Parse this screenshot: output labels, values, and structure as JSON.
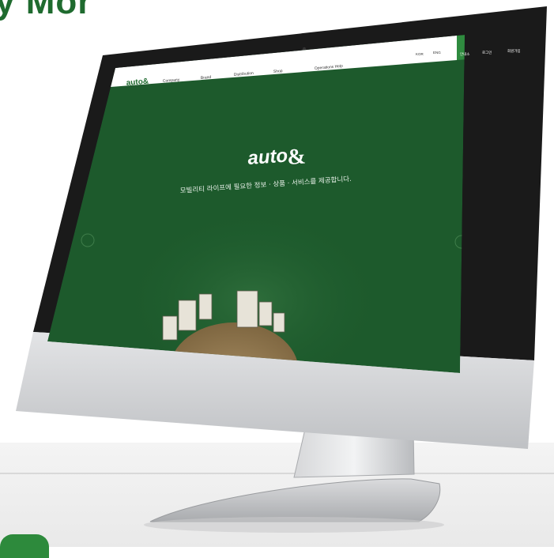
{
  "headline": "y Mor",
  "site": {
    "logo_text": "auto",
    "logo_mark": "&",
    "nav": [
      "Company",
      "Brand",
      "Distribution",
      "Shop",
      "Operations Help"
    ],
    "utility_labels": [
      "KOR",
      "ENG"
    ],
    "side_buttons": [
      "안내소",
      "로그인",
      "회원가입"
    ],
    "hero": {
      "brand": "auto",
      "brand_mark": "&",
      "tagline": "모빌리티 라이프에 필요한 정보 · 상품 · 서비스를 제공합니다."
    }
  },
  "colors": {
    "brand_green": "#1f6b2f",
    "screen_green": "#1d5a2c",
    "active_tab": "#2f8b3f"
  },
  "icons": [
    "left-arrow-icon",
    "right-arrow-icon",
    "menu-icon",
    "user-icon"
  ]
}
